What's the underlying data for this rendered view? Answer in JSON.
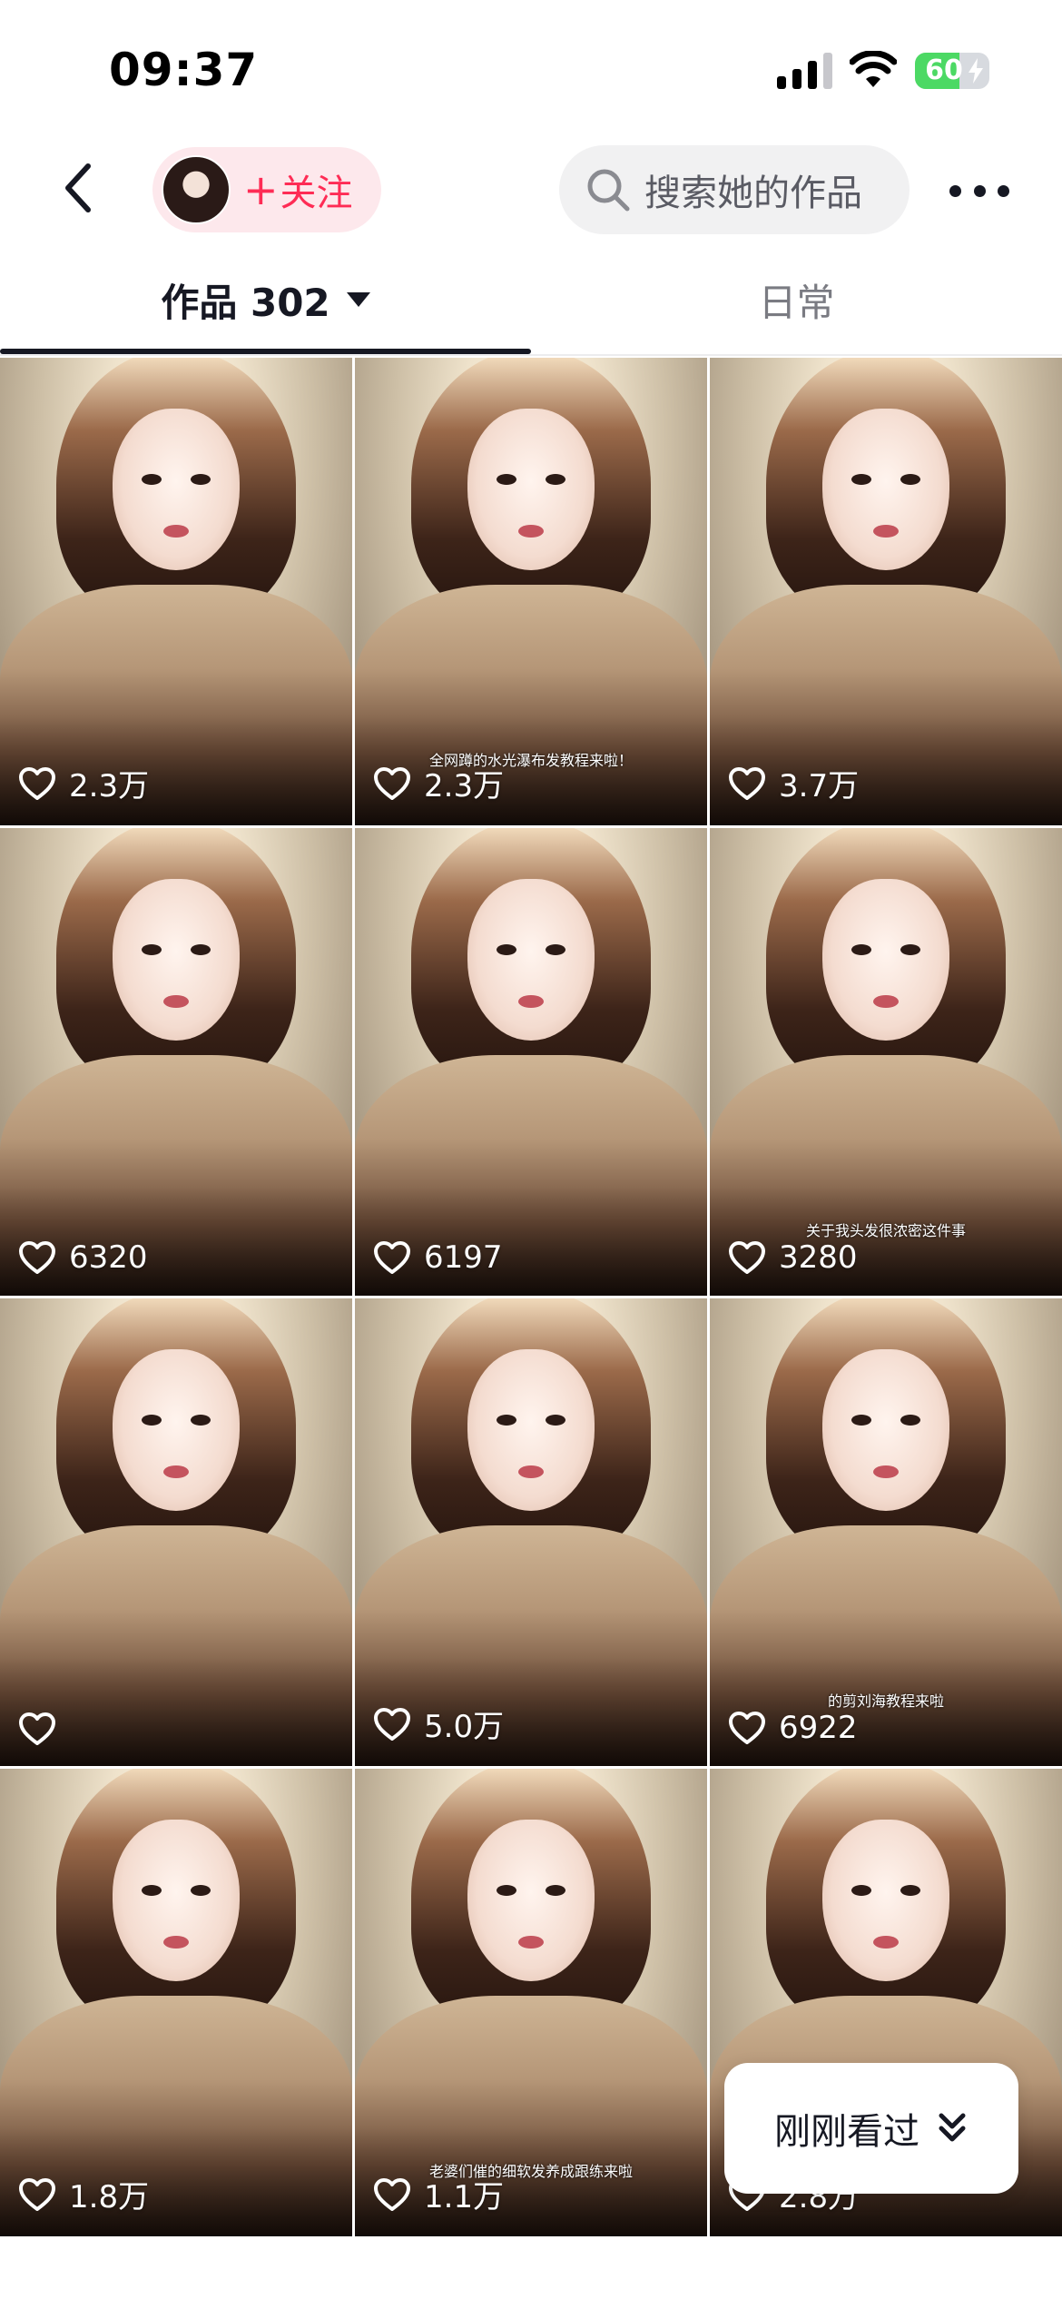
{
  "status_bar": {
    "time": "09:37",
    "battery_percent": "60",
    "battery_level": 0.6,
    "signal_icon": "cellular-signal-icon",
    "wifi_icon": "wifi-icon",
    "charging_icon": "lightning-bolt-icon"
  },
  "header": {
    "back_icon": "chevron-left-icon",
    "follow_plus": "+",
    "follow_label": "关注",
    "search_placeholder": "搜索她的作品",
    "search_icon": "search-icon",
    "more_icon": "more-dots-icon",
    "accent_color": "#fe2c55"
  },
  "tabs": {
    "works_label": "作品 302",
    "daily_label": "日常"
  },
  "videos": [
    {
      "likes": "2.3万",
      "caption": ""
    },
    {
      "likes": "2.3万",
      "caption": "全网蹲的水光瀑布发教程来啦！"
    },
    {
      "likes": "3.7万",
      "caption": ""
    },
    {
      "likes": "6320",
      "caption": ""
    },
    {
      "likes": "6197",
      "caption": ""
    },
    {
      "likes": "3280",
      "caption": "关于我头发很浓密这件事"
    },
    {
      "likes": "",
      "caption": ""
    },
    {
      "likes": "5.0万",
      "caption": ""
    },
    {
      "likes": "6922",
      "caption": "的剪刘海教程来啦"
    },
    {
      "likes": "1.8万",
      "caption": ""
    },
    {
      "likes": "1.1万",
      "caption": "老婆们催的细软发养成跟练来啦"
    },
    {
      "likes": "2.8万",
      "caption": ""
    }
  ],
  "recent_button": {
    "label": "刚刚看过",
    "icon": "double-chevron-down-icon"
  }
}
